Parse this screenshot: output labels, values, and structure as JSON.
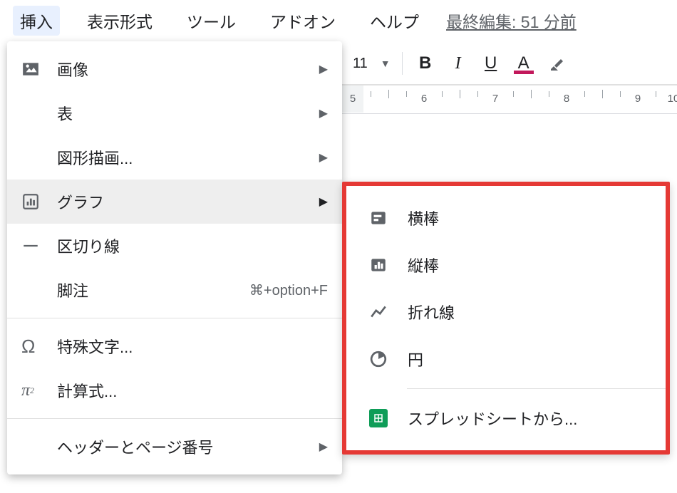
{
  "menubar": {
    "items": [
      {
        "label": "挿入",
        "active": true
      },
      {
        "label": "表示形式",
        "active": false
      },
      {
        "label": "ツール",
        "active": false
      },
      {
        "label": "アドオン",
        "active": false
      },
      {
        "label": "ヘルプ",
        "active": false
      }
    ],
    "last_edit": "最終編集: 51 分前"
  },
  "toolbar": {
    "font_size": "11",
    "bold": "B",
    "italic": "I",
    "underline": "U",
    "textcolor": "A"
  },
  "ruler": {
    "start": 5,
    "end": 10
  },
  "insert_menu": {
    "image": "画像",
    "table": "表",
    "drawing": "図形描画...",
    "chart": "グラフ",
    "hr": "区切り線",
    "footnote": "脚注",
    "footnote_shortcut": "⌘+option+F",
    "special": "特殊文字...",
    "equation": "計算式...",
    "header_page": "ヘッダーとページ番号"
  },
  "chart_submenu": {
    "bar_h": "横棒",
    "bar_v": "縦棒",
    "line": "折れ線",
    "pie": "円",
    "sheets": "スプレッドシートから..."
  }
}
